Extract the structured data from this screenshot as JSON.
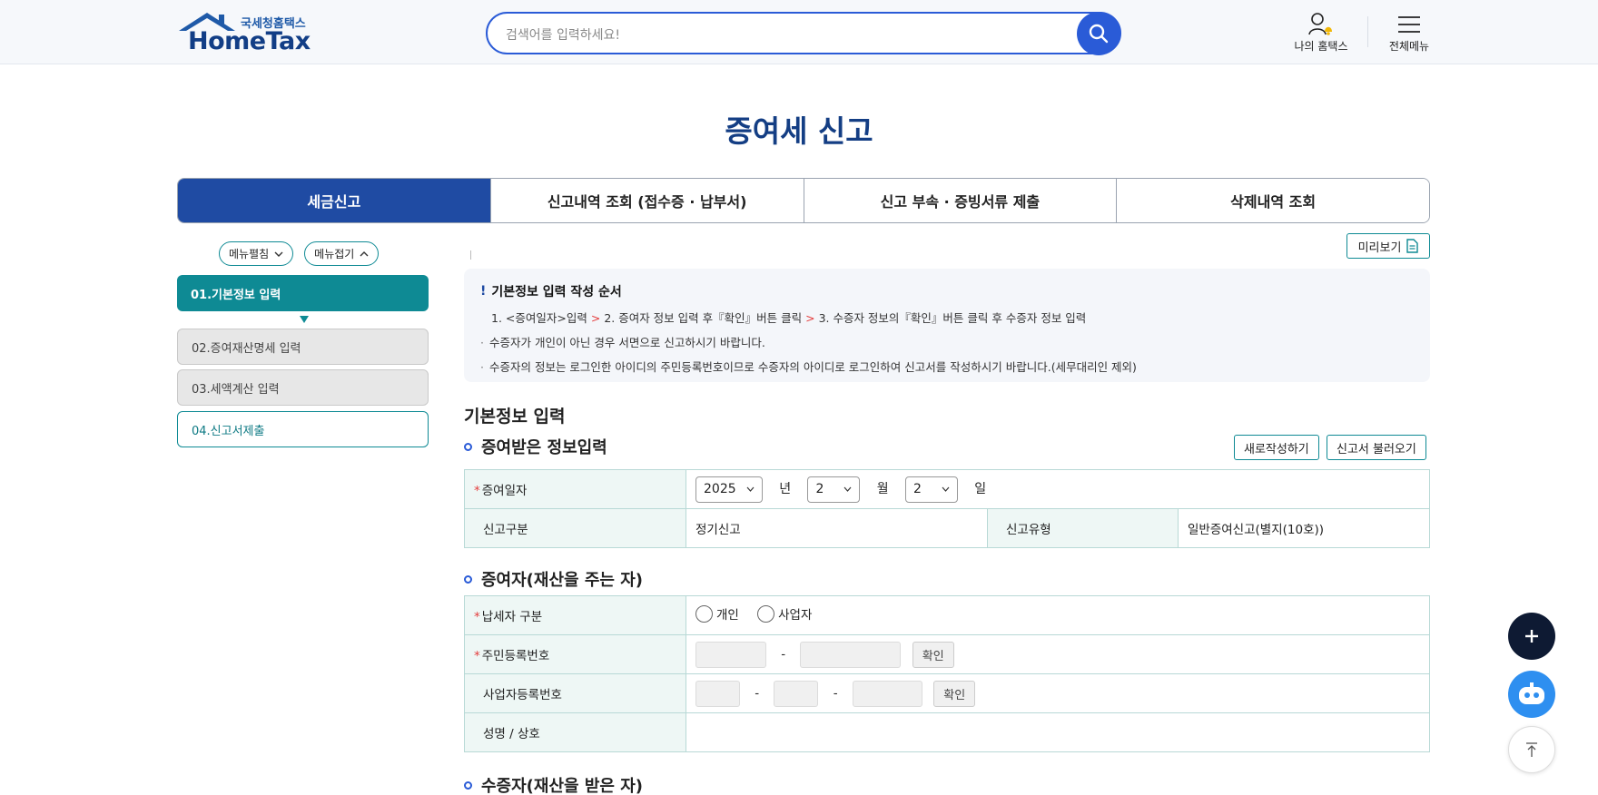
{
  "header": {
    "logo_small": "국세청홈택스",
    "logo_big": "HomeTax",
    "search_placeholder": "검색어를 입력하세요!",
    "my_hometax": "나의 홈택스",
    "all_menu": "전체메뉴"
  },
  "page_title": "증여세 신고",
  "tabs": [
    {
      "label": "세금신고",
      "active": true
    },
    {
      "label": "신고내역 조회 (접수증 · 납부서)",
      "active": false
    },
    {
      "label": "신고 부속 · 증빙서류 제출",
      "active": false
    },
    {
      "label": "삭제내역 조회",
      "active": false
    }
  ],
  "menu": {
    "expand": "메뉴펼침",
    "collapse": "메뉴접기",
    "steps": [
      {
        "label": "01.기본정보 입력",
        "state": "active"
      },
      {
        "label": "02.증여재산명세 입력",
        "state": "done"
      },
      {
        "label": "03.세액계산 입력",
        "state": "done"
      },
      {
        "label": "04.신고서제출",
        "state": "next"
      }
    ]
  },
  "preview": "미리보기",
  "guide": {
    "title": "기본정보 입력 작성 순서",
    "step1": "1. <증여일자>입력",
    "step2": "2. 증여자 정보 입력 후『확인』버튼 클릭",
    "step3": "3. 수증자 정보의『확인』버튼 클릭 후 수증자 정보 입력",
    "gt": ">",
    "note1": "수증자가 개인이 아닌 경우 서면으로 신고하시기 바랍니다.",
    "note2": "수증자의 정보는 로그인한 아이디의 주민등록번호이므로 수증자의 아이디로 로그인하여 신고서를 작성하시기 바랍니다.(세무대리인 제외)"
  },
  "section_title": "기본정보 입력",
  "received": {
    "title": "증여받은 정보입력",
    "new_btn": "새로작성하기",
    "load_btn": "신고서 불러오기",
    "date_label": "증여일자",
    "year": "2025",
    "year_unit": "년",
    "month": "2",
    "month_unit": "월",
    "day": "2",
    "day_unit": "일",
    "type_label": "신고구분",
    "type_value": "정기신고",
    "kind_label": "신고유형",
    "kind_value": "일반증여신고(별지(10호))"
  },
  "donor": {
    "title": "증여자(재산을 주는 자)",
    "taxpayer_label": "납세자 구분",
    "opt_person": "개인",
    "opt_business": "사업자",
    "rrn_label": "주민등록번호",
    "brn_label": "사업자등록번호",
    "name_label": "성명 / 상호",
    "dash": "-",
    "confirm": "확인"
  },
  "recipient": {
    "title": "수증자(재산을 받은 자)"
  },
  "required_mark": "*",
  "colors": {
    "primary": "#1f4ba3",
    "teal": "#0e8a94",
    "accent_blue": "#2a5bd7",
    "required": "#e43c3c"
  }
}
